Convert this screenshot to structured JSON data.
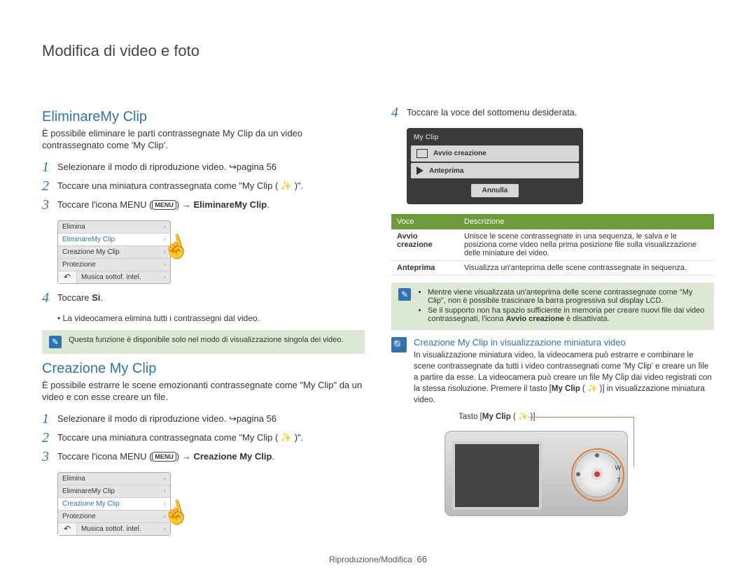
{
  "page_title": "Modifica di video e foto",
  "footer": {
    "section": "Riproduzione/Modifica",
    "page_number": "66"
  },
  "left": {
    "sec1_title": "EliminareMy Clip",
    "sec1_intro": "È possibile eliminare le parti contrassegnate My Clip da un video contrassegnato come 'My Clip'.",
    "s1": {
      "text_a": "Selezionare il modo di riproduzione video. ",
      "page_ref": "pagina 56"
    },
    "s2": {
      "text": "Toccare una miniatura contrassegnata come \"My Clip ( ✨ )\"."
    },
    "s3": {
      "text_a": "Toccare l'icona MENU (",
      "menu_label": "MENU",
      "text_b": ") ",
      "arrow": "→",
      "strong": " EliminareMy Clip",
      "dot": "."
    },
    "s4": {
      "text_a": "Toccare ",
      "strong": "Sì",
      "dot": "."
    },
    "s4_bullet": "La videocamera elimina tutti i contrassegni dal video.",
    "note1": "Questa funzione è disponibile solo nel modo di visualizzazione singola dei video.",
    "sec2_title": "Creazione My Clip",
    "sec2_intro": "È possibile estrarre le scene emozionanti contrassegnate come \"My Clip\" da un video e con esse creare un file.",
    "c1": {
      "text_a": "Selezionare il modo di riproduzione video. ",
      "page_ref": "pagina 56"
    },
    "c2": {
      "text": "Toccare una miniatura contrassegnata come \"My Clip ( ✨ )\"."
    },
    "c3": {
      "text_a": "Toccare l'icona MENU (",
      "menu_label": "MENU",
      "text_b": ") ",
      "arrow": "→",
      "strong": " Creazione My Clip",
      "dot": "."
    },
    "menu1": {
      "items": [
        "Elimina",
        "EliminareMy Clip",
        "Creazione My Clip",
        "Protezione",
        "Musica sottof. intel."
      ],
      "selected_index": 1,
      "back_icon": "↶"
    },
    "menu2": {
      "items": [
        "Elimina",
        "EliminareMy Clip",
        "Creazione My Clip",
        "Protezione",
        "Musica sottof. intel."
      ],
      "selected_index": 2,
      "back_icon": "↶"
    }
  },
  "right": {
    "r4": "Toccare la voce del sottomenu desiderata.",
    "submenu": {
      "title": "My Clip",
      "item1": "Avvio creazione",
      "item2": "Anteprima",
      "cancel": "Annulla"
    },
    "table": {
      "h1": "Voce",
      "h2": "Descrizione",
      "r1k": "Avvio creazione",
      "r1v": "Unisce le scene contrassegnate in una sequenza, le salva e le posiziona come video nella prima posizione file sulla visualizzazione delle miniature dei video.",
      "r2k": "Anteprima",
      "r2v": "Visualizza un'anteprima delle scene contrassegnate in sequenza."
    },
    "note2_a": "Mentre viene visualizzata un'anteprima delle scene contrassegnate come \"My Clip\", non è possibile trascinare la barra progressiva sul display LCD.",
    "note2_b_a": "Se il supporto non ha spazio sufficiente in memoria per creare nuovi file dai video contrassegnati, l'icona ",
    "note2_b_strong": "Avvio creazione",
    "note2_b_b": " è disattivata.",
    "feature": {
      "title": "Creazione My Clip in visualizzazione miniatura video",
      "body_a": "In visualizzazione miniatura video, la videocamera può estrarre e combinare le scene contrassegnate da tutti i video contrassegnati come 'My Clip' e creare un file a partire da esse. La videocamera può creare un file My Clip dai video registrati con la stessa risoluzione. Premere il tasto [",
      "body_strong1": "My Clip",
      "body_b": " ( ✨ )] in visualizzazione miniatura video.",
      "tasto_a": "Tasto [",
      "tasto_strong": "My Clip",
      "tasto_b": " ( ✨ )]"
    }
  }
}
